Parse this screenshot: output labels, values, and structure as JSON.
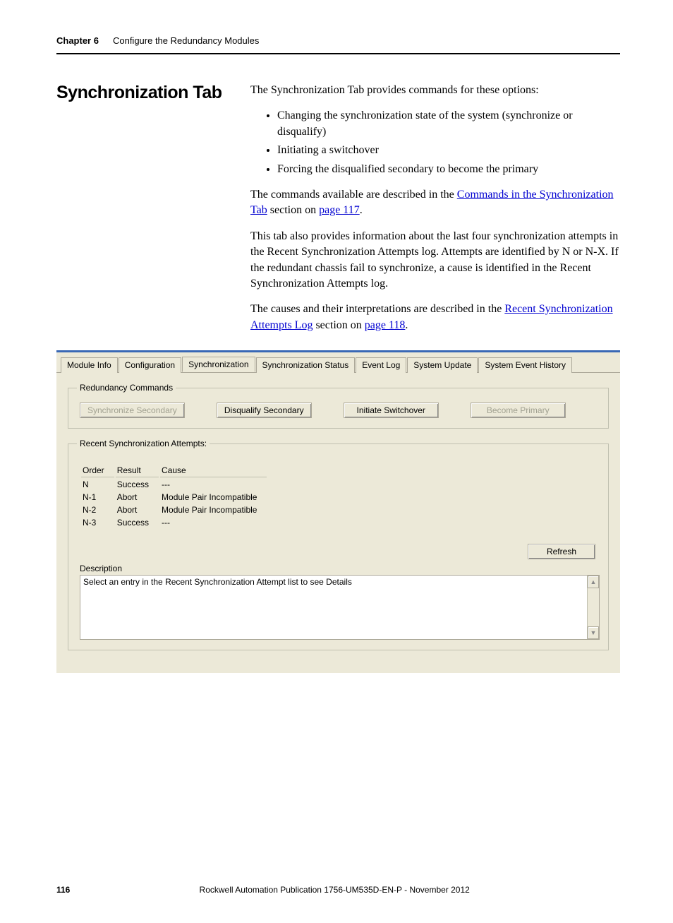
{
  "header": {
    "chapter_label": "Chapter 6",
    "chapter_title": "Configure the Redundancy Modules"
  },
  "section": {
    "heading": "Synchronization Tab",
    "intro": "The Synchronization Tab provides commands for these options:",
    "bullets": [
      "Changing the synchronization state of the system (synchronize or disqualify)",
      "Initiating a switchover",
      "Forcing the disqualified secondary to become the primary"
    ],
    "para2_pre": "The commands available are described in the ",
    "para2_link": "Commands in the Synchronization Tab",
    "para2_mid": " section on ",
    "para2_page_link": "page 117",
    "para2_end": ".",
    "para3": "This tab also provides information about the last four synchronization attempts in the Recent Synchronization Attempts log. Attempts are identified by N or N-X. If the redundant chassis fail to synchronize, a cause is identified in the Recent Synchronization Attempts log.",
    "para4_pre": "The causes and their interpretations are described in the ",
    "para4_link": "Recent Synchronization Attempts Log",
    "para4_mid": " section on ",
    "para4_page_link": "page 118",
    "para4_end": "."
  },
  "ui": {
    "tabs": [
      "Module Info",
      "Configuration",
      "Synchronization",
      "Synchronization Status",
      "Event Log",
      "System Update",
      "System Event History"
    ],
    "active_tab_index": 2,
    "commands_legend": "Redundancy Commands",
    "buttons": {
      "sync": "Synchronize Secondary",
      "disqualify": "Disqualify Secondary",
      "switchover": "Initiate Switchover",
      "primary": "Become Primary"
    },
    "attempts_legend": "Recent Synchronization Attempts:",
    "columns": {
      "order": "Order",
      "result": "Result",
      "cause": "Cause"
    },
    "rows": [
      {
        "order": "N",
        "result": "Success",
        "cause": "---"
      },
      {
        "order": "N-1",
        "result": "Abort",
        "cause": "Module Pair Incompatible"
      },
      {
        "order": "N-2",
        "result": "Abort",
        "cause": "Module Pair Incompatible"
      },
      {
        "order": "N-3",
        "result": "Success",
        "cause": "---"
      }
    ],
    "refresh": "Refresh",
    "desc_label": "Description",
    "desc_text": "Select an entry in the Recent Synchronization Attempt list to see Details"
  },
  "footer": {
    "page": "116",
    "pub": "Rockwell Automation Publication 1756-UM535D-EN-P - November 2012"
  }
}
